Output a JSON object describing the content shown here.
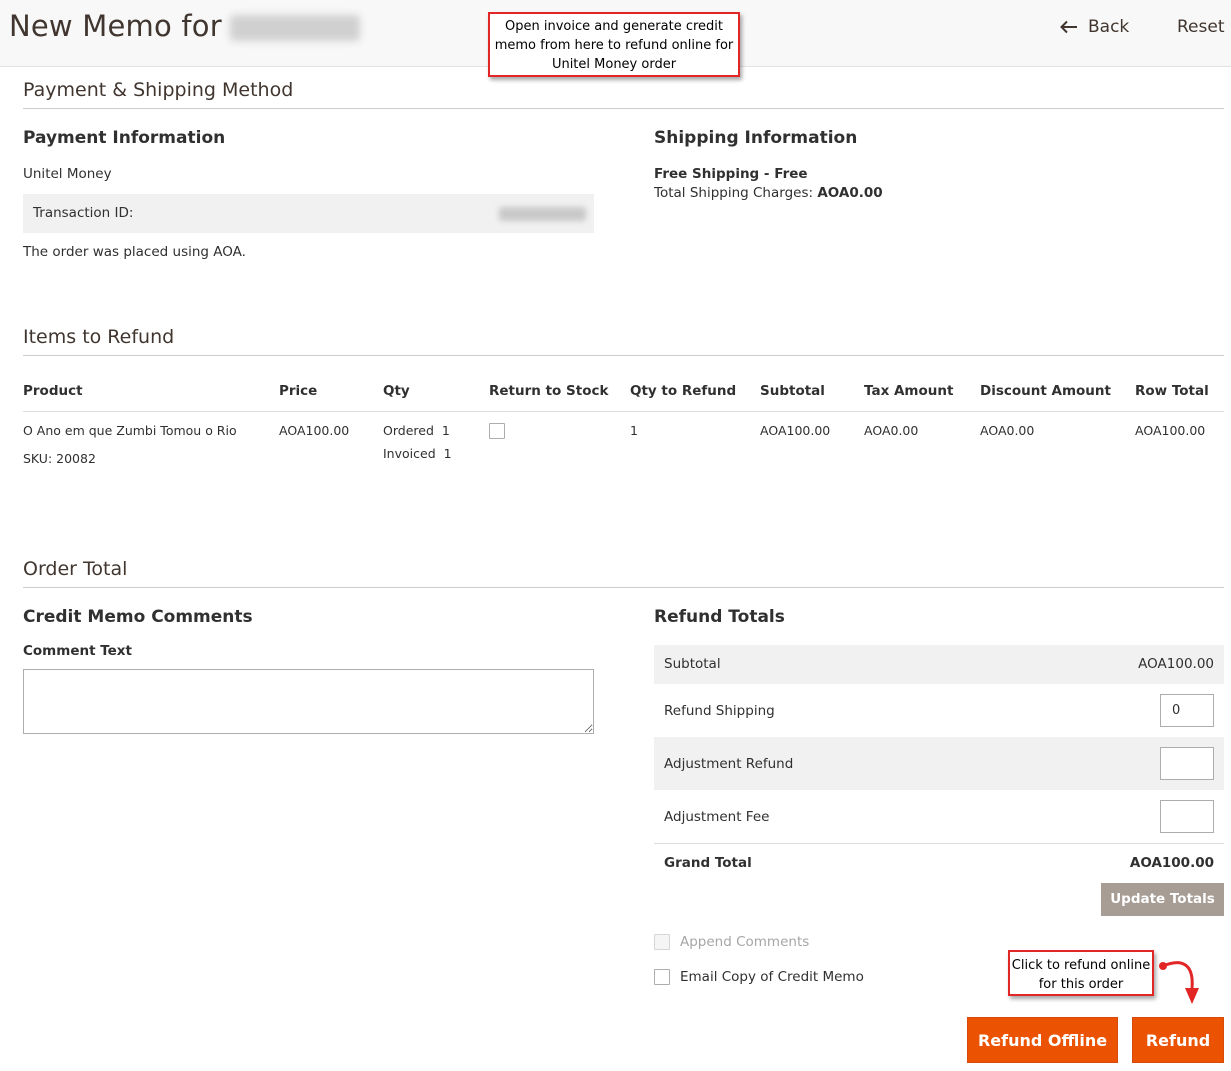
{
  "header": {
    "title": "New Memo for",
    "back_label": "Back",
    "reset_label": "Reset"
  },
  "annotations": {
    "top_note": "Open invoice and generate credit memo from here to refund online for Unitel Money order",
    "refund_note": "Click to refund online for this order"
  },
  "payment_shipping": {
    "section_title": "Payment & Shipping Method",
    "payment": {
      "title": "Payment Information",
      "method": "Unitel Money",
      "transaction_label": "Transaction ID:",
      "placed_note": "The order was placed using AOA."
    },
    "shipping": {
      "title": "Shipping Information",
      "method": "Free Shipping - Free",
      "charges_label": "Total Shipping Charges:",
      "charges_value": "AOA0.00"
    }
  },
  "items": {
    "section_title": "Items to Refund",
    "columns": [
      "Product",
      "Price",
      "Qty",
      "Return to Stock",
      "Qty to Refund",
      "Subtotal",
      "Tax Amount",
      "Discount Amount",
      "Row Total"
    ],
    "rows": [
      {
        "product": "O Ano em que Zumbi Tomou o Rio",
        "sku": "SKU: 20082",
        "price": "AOA100.00",
        "ordered_label": "Ordered",
        "ordered_qty": "1",
        "invoiced_label": "Invoiced",
        "invoiced_qty": "1",
        "qty_to_refund": "1",
        "subtotal": "AOA100.00",
        "tax": "AOA0.00",
        "discount": "AOA0.00",
        "row_total": "AOA100.00"
      }
    ]
  },
  "order_total": {
    "section_title": "Order Total",
    "comments": {
      "title": "Credit Memo Comments",
      "comment_label": "Comment Text"
    },
    "refund_totals": {
      "title": "Refund Totals",
      "subtotal_label": "Subtotal",
      "subtotal_value": "AOA100.00",
      "refund_shipping_label": "Refund Shipping",
      "refund_shipping_value": "0",
      "adjustment_refund_label": "Adjustment Refund",
      "adjustment_fee_label": "Adjustment Fee",
      "grand_total_label": "Grand Total",
      "grand_total_value": "AOA100.00",
      "update_totals_label": "Update Totals"
    },
    "options": {
      "append_comments_label": "Append Comments",
      "email_copy_label": "Email Copy of Credit Memo"
    },
    "actions": {
      "refund_offline_label": "Refund Offline",
      "refund_label": "Refund"
    }
  },
  "colors": {
    "accent": "#eb5202",
    "annotation_border": "#e22626",
    "disabled_button": "#a79d95"
  }
}
